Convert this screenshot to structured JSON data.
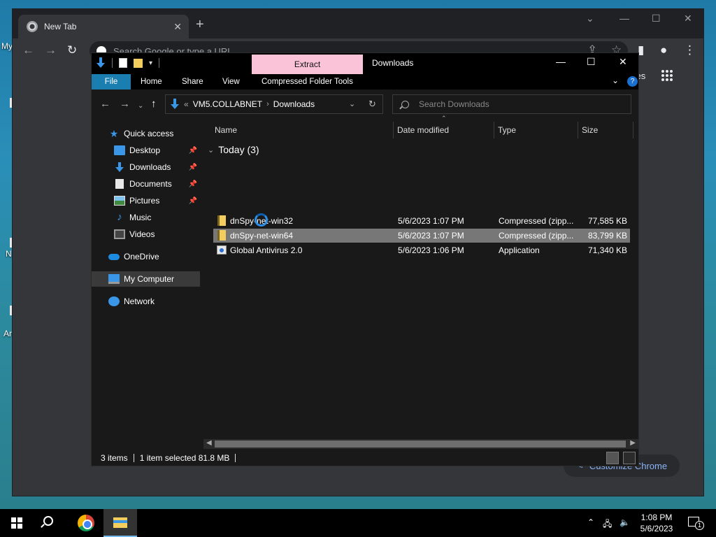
{
  "desktop": {
    "icon_labels": [
      "My",
      "N",
      "Ar"
    ]
  },
  "chrome": {
    "tab_title": "New Tab",
    "omnibox_placeholder": "Search Google or type a URL",
    "ntp_images_label": "ages",
    "customize_label": "Customize Chrome"
  },
  "explorer": {
    "window_title": "Downloads",
    "contextual_tab": "Extract",
    "ribbon_tabs": [
      "File",
      "Home",
      "Share",
      "View",
      "Compressed Folder Tools"
    ],
    "address": {
      "overflow": "«",
      "crumbs": [
        "VM5.COLLABNET",
        "Downloads"
      ]
    },
    "search_placeholder": "Search Downloads",
    "nav_items": [
      {
        "label": "Quick access",
        "icon": "star-icon"
      },
      {
        "label": "Desktop",
        "icon": "desktop-icon",
        "pinned": true
      },
      {
        "label": "Downloads",
        "icon": "download-icon",
        "pinned": true
      },
      {
        "label": "Documents",
        "icon": "document-icon",
        "pinned": true
      },
      {
        "label": "Pictures",
        "icon": "pictures-icon",
        "pinned": true
      },
      {
        "label": "Music",
        "icon": "music-icon"
      },
      {
        "label": "Videos",
        "icon": "video-icon"
      },
      {
        "label": "OneDrive",
        "icon": "cloud-icon"
      },
      {
        "label": "My Computer",
        "icon": "computer-icon",
        "selected": true
      },
      {
        "label": "Network",
        "icon": "network-icon"
      }
    ],
    "columns": [
      "Name",
      "Date modified",
      "Type",
      "Size"
    ],
    "group_label": "Today (3)",
    "files": [
      {
        "name": "dnSpy-net-win32",
        "date": "5/6/2023 1:07 PM",
        "type": "Compressed (zipp...",
        "size": "77,585 KB",
        "icon": "zip-folder-icon"
      },
      {
        "name": "dnSpy-net-win64",
        "date": "5/6/2023 1:07 PM",
        "type": "Compressed (zipp...",
        "size": "83,799 KB",
        "icon": "zip-folder-icon",
        "selected": true
      },
      {
        "name": "Global Antivirus  2.0",
        "date": "5/6/2023 1:06 PM",
        "type": "Application",
        "size": "71,340 KB",
        "icon": "application-icon"
      }
    ],
    "status": {
      "items": "3 items",
      "selection": "1 item selected  81.8 MB"
    }
  },
  "taskbar": {
    "time": "1:08 PM",
    "date": "5/6/2023",
    "notification_count": "1"
  },
  "colors": {
    "extract_tab": "#fbc3d8",
    "file_tab": "#1a7fb0",
    "accent_blue": "#3a96e6",
    "selection": "#777777"
  }
}
